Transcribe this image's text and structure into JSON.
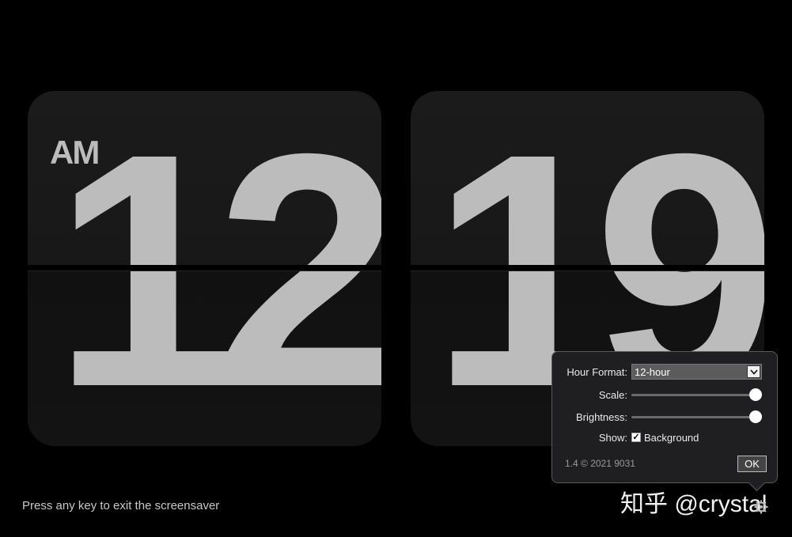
{
  "clock": {
    "period": "AM",
    "hours": "12",
    "minutes": "19"
  },
  "hint": "Press any key to exit the screensaver",
  "watermark": "知乎 @crystal",
  "settings": {
    "hour_format": {
      "label": "Hour Format:",
      "selected": "12-hour"
    },
    "scale": {
      "label": "Scale:",
      "value": 1.0
    },
    "brightness": {
      "label": "Brightness:",
      "value": 1.0
    },
    "show": {
      "label": "Show:",
      "option_label": "Background",
      "checked": true
    },
    "version": "1.4 © 2021 9031",
    "ok_label": "OK"
  },
  "icons": {
    "select_arrow": "chevron-down-icon",
    "gear": "gear-icon",
    "check": "checkmark-icon"
  },
  "colors": {
    "background": "#000000",
    "card": "#181818",
    "digit": "#bcbcbc",
    "panel": "#1f1f21"
  }
}
